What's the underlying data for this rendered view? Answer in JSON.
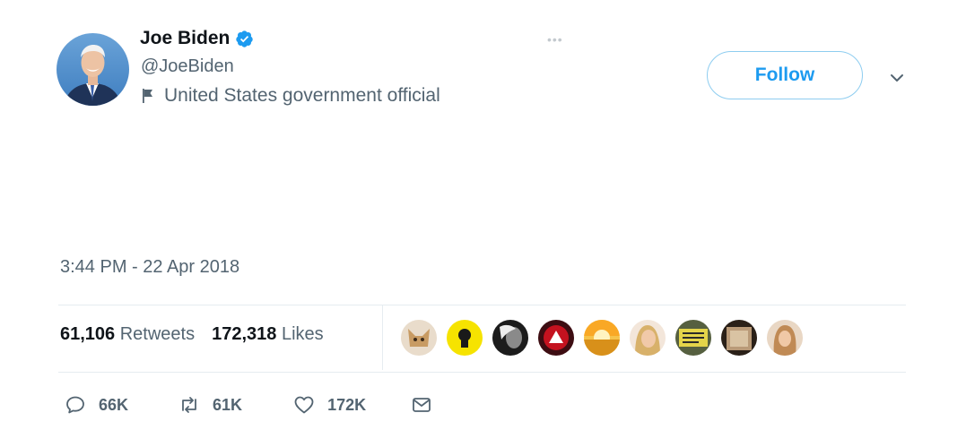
{
  "author": {
    "display_name": "Joe Biden",
    "handle": "@JoeBiden",
    "affiliation": "United States government official",
    "verified_icon": "verified-badge-icon"
  },
  "header": {
    "follow_label": "Follow",
    "more_icon": "more-dots-icon",
    "menu_icon": "chevron-down-icon"
  },
  "tweet": {
    "timestamp": "3:44 PM - 22 Apr 2018"
  },
  "stats": {
    "retweets_count": "61,106",
    "retweets_label": "Retweets",
    "likes_count": "172,318",
    "likes_label": "Likes"
  },
  "actions": {
    "replies": "66K",
    "retweets": "61K",
    "likes": "172K"
  },
  "colors": {
    "accent": "#1d9bf0",
    "muted": "#536471",
    "text": "#0f1419",
    "divider": "#e6ecf0"
  }
}
